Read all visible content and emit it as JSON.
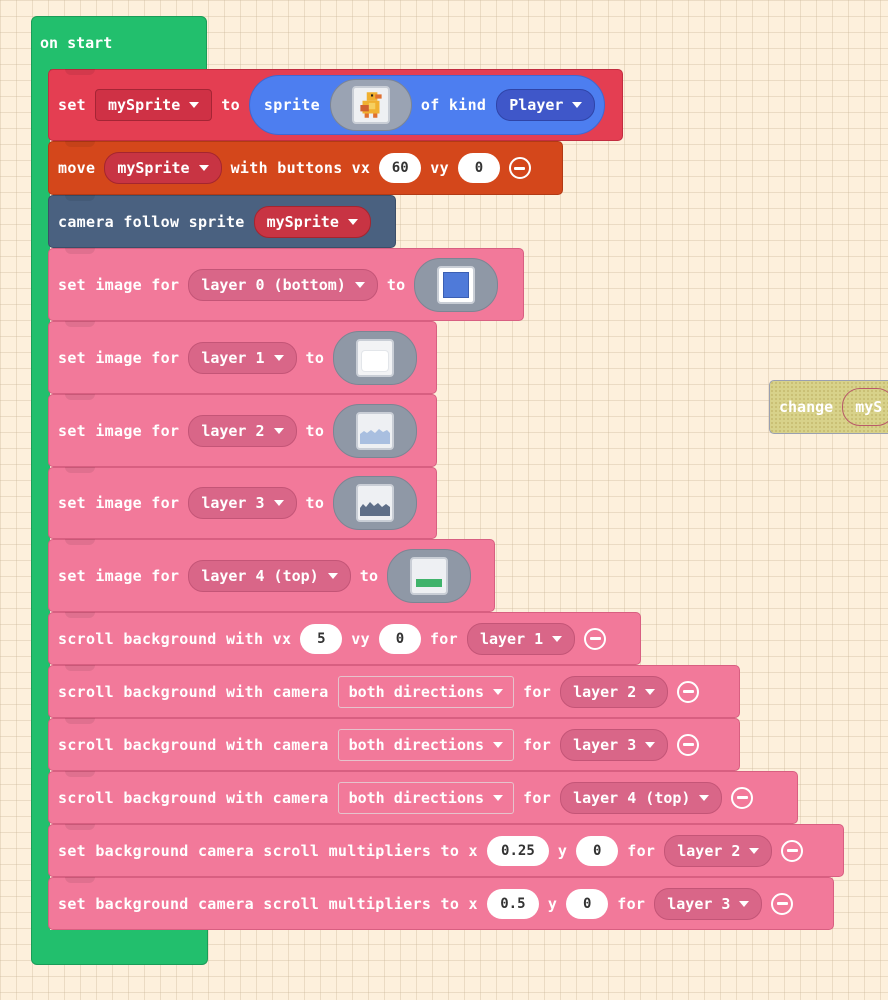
{
  "on_start": {
    "label": "on start"
  },
  "set_sprite": {
    "set": "set",
    "var": "mySprite",
    "to": "to",
    "sprite": "sprite",
    "of_kind": "of kind",
    "kind": "Player"
  },
  "move": {
    "move": "move",
    "var": "mySprite",
    "with_buttons": "with buttons",
    "vx_label": "vx",
    "vx": "60",
    "vy_label": "vy",
    "vy": "0"
  },
  "camera": {
    "label": "camera follow sprite",
    "var": "mySprite"
  },
  "layers": [
    {
      "pre": "set image for",
      "layer": "layer 0 (bottom)",
      "to": "to",
      "image": "blue-square"
    },
    {
      "pre": "set image for",
      "layer": "layer 1",
      "to": "to",
      "image": "white-cloud"
    },
    {
      "pre": "set image for",
      "layer": "layer 2",
      "to": "to",
      "image": "light-blue-hills"
    },
    {
      "pre": "set image for",
      "layer": "layer 3",
      "to": "to",
      "image": "dark-slate-hills"
    },
    {
      "pre": "set image for",
      "layer": "layer 4 (top)",
      "to": "to",
      "image": "green-ground"
    }
  ],
  "scroll_vx": {
    "pre": "scroll background with vx",
    "vx": "5",
    "vy_label": "vy",
    "vy": "0",
    "for": "for",
    "layer": "layer 1"
  },
  "scroll_camera": [
    {
      "pre": "scroll background with camera",
      "mode": "both directions",
      "for": "for",
      "layer": "layer 2"
    },
    {
      "pre": "scroll background with camera",
      "mode": "both directions",
      "for": "for",
      "layer": "layer 3"
    },
    {
      "pre": "scroll background with camera",
      "mode": "both directions",
      "for": "for",
      "layer": "layer 4 (top)"
    }
  ],
  "multipliers": [
    {
      "pre": "set background camera scroll multipliers to x",
      "x": "0.25",
      "y_label": "y",
      "y": "0",
      "for": "for",
      "layer": "layer 2"
    },
    {
      "pre": "set background camera scroll multipliers to x",
      "x": "0.5",
      "y_label": "y",
      "y": "0",
      "for": "for",
      "layer": "layer 3"
    }
  ],
  "ghost": {
    "label": "change",
    "var": "myS"
  },
  "colors": {
    "events": "#22bf6d",
    "scene": "#f2799a",
    "sprites": "#e43e52",
    "controller": "#d4471b",
    "camera": "#4a6180",
    "sprite_oval": "#4d7ef0",
    "workspace": "#fdf0dc"
  }
}
